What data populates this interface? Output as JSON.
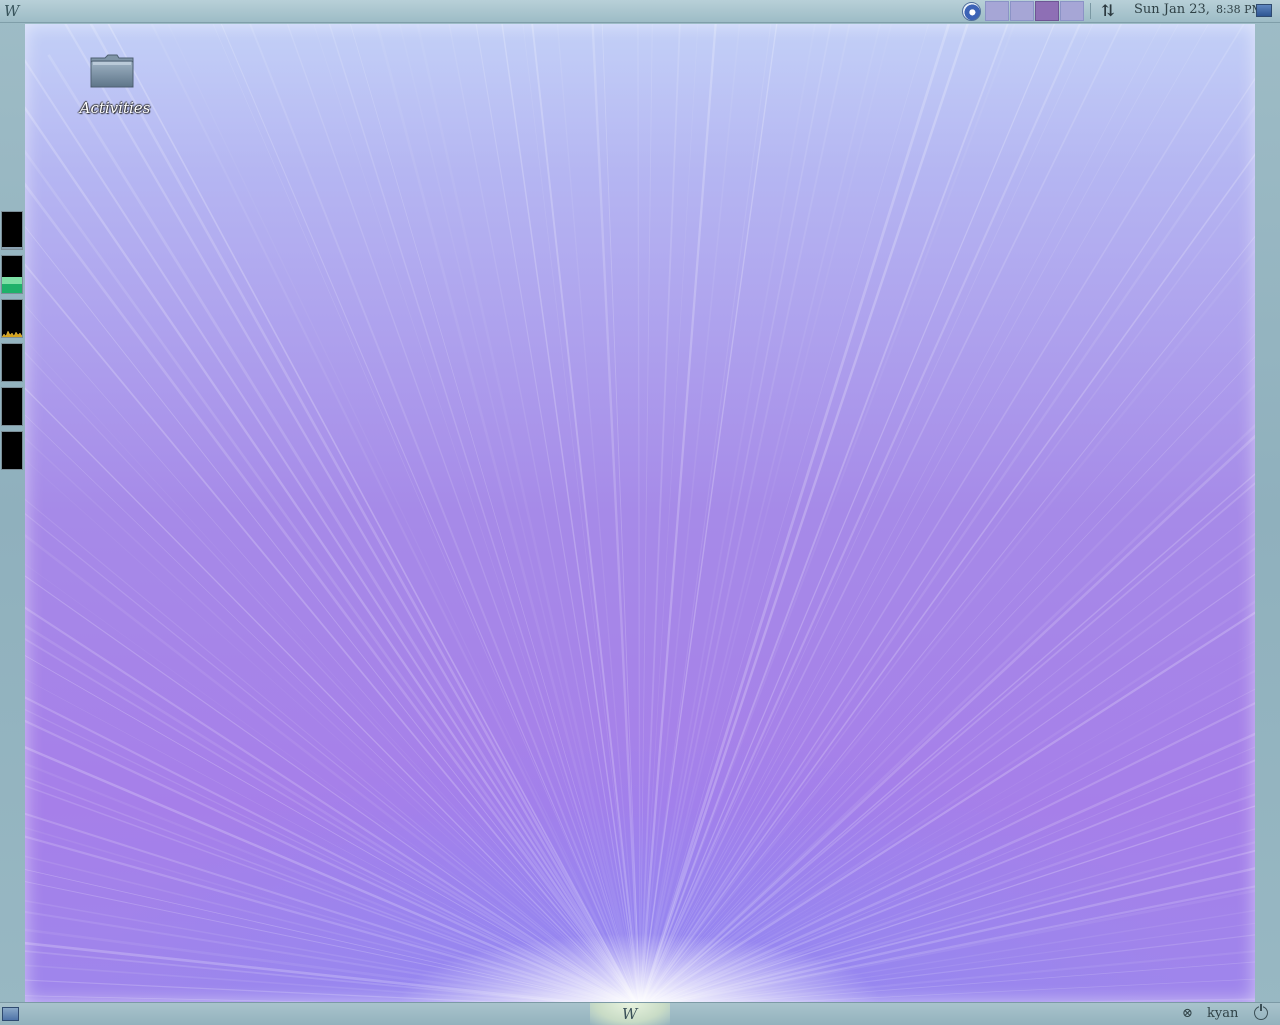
{
  "top_panel": {
    "logo": "W",
    "browser_icon": "web-browser-icon",
    "pager": {
      "desktops": 4,
      "active_index": 2
    },
    "network_icon": "network-arrows-icon",
    "clock": {
      "date": "Sun Jan 23,",
      "time": "8:38 PM"
    },
    "show_desktop_icon": "monitor-icon"
  },
  "side_monitors": {
    "count": 6
  },
  "desktop": {
    "icons": [
      {
        "label": "Activities",
        "icon": "folder-icon"
      }
    ]
  },
  "bottom_panel": {
    "logo": "W",
    "show_desktop_icon": "window-list-icon",
    "user": {
      "icon": "user-switch-icon",
      "name": "kyan"
    },
    "power_icon": "power-icon"
  },
  "colors": {
    "panel": "#9dbcc6",
    "desktop_top": "#c3d0f7",
    "desktop_mid": "#a68ae8",
    "pager_active": "#8e6fb5",
    "pager_inactive": "#a6a6d6"
  }
}
